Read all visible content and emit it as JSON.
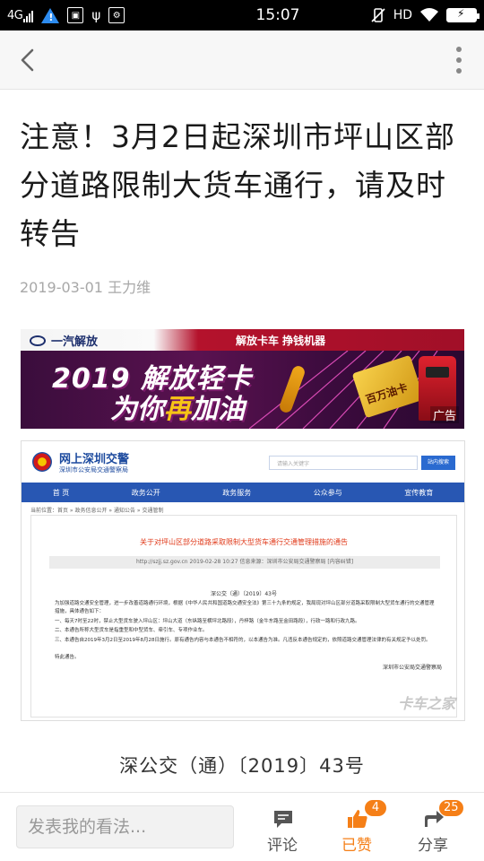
{
  "statusbar": {
    "network": "4G",
    "time": "15:07",
    "hd": "HD",
    "battery_icon": "battery-charging-icon"
  },
  "navbar": {
    "back_icon": "chevron-left-icon",
    "more_icon": "vertical-dots-icon"
  },
  "article": {
    "title": "注意！3月2日起深圳市坪山区部分道路限制大货车通行，请及时转告",
    "date": "2019-03-01",
    "author": "王力维"
  },
  "ad": {
    "brand": "一汽解放",
    "slogan": "解放卡车 挣钱机器",
    "line1": "2019 解放轻卡",
    "line2_a": "为你",
    "line2_b": "再",
    "line2_c": "加油",
    "card_text": "百万油卡",
    "label": "广告"
  },
  "doc": {
    "site_name": "网上深圳交警",
    "site_org": "深圳市公安局交通警察局",
    "search_placeholder": "请输入关键字",
    "search_button": "站内搜索",
    "nav": [
      "首 页",
      "政务公开",
      "政务服务",
      "公众参与",
      "宣传教育"
    ],
    "breadcrumb": "当前位置：首页 » 政务信息公开 » 通知公告 » 交通管制",
    "title": "关于对坪山区部分道路采取限制大型货车通行交通管理措施的通告",
    "info_bar": "http://szjj.sz.gov.cn    2019-02-28 10:27    信息来源：深圳市公安局交通警察局    [内容纠错]",
    "doc_number": "深公交（通）〔2019〕43号",
    "paragraphs": [
      "为加强道路交通安全管理，进一步改善道路通行环境，根据《中华人民共和国道路交通安全法》第三十九条的规定，我局现对坪山区部分道路采取限制大型货车通行的交通管理措施，具体通告如下：",
      "一、每天7时至22时，禁止大型货车驶入坪山区：坪山大道（东纵路至横坪北路段），丹梓路（金牛东路至金田路段），行政一路和行政九路。",
      "二、本通告所称大型货车是指重型和中型货车、牵引车、专项作业车。",
      "三、本通告自2019年3月2日至2019年8月28日施行。原有通告内容与本通告不相符的，以本通告为准。凡违反本通告规定的，依照道路交通管理法律的有关规定予以处罚。",
      "特此通告。"
    ],
    "signature": "深圳市公安局交通警察局",
    "watermark": "卡车之家"
  },
  "caption": "深公交（通）〔2019〕43号",
  "bottom": {
    "comment_placeholder": "发表我的看法...",
    "comment_label": "评论",
    "like_label": "已赞",
    "like_count": "4",
    "share_label": "分享",
    "share_count": "25"
  },
  "colors": {
    "accent": "#f57f17",
    "doc_nav": "#2857b3"
  }
}
